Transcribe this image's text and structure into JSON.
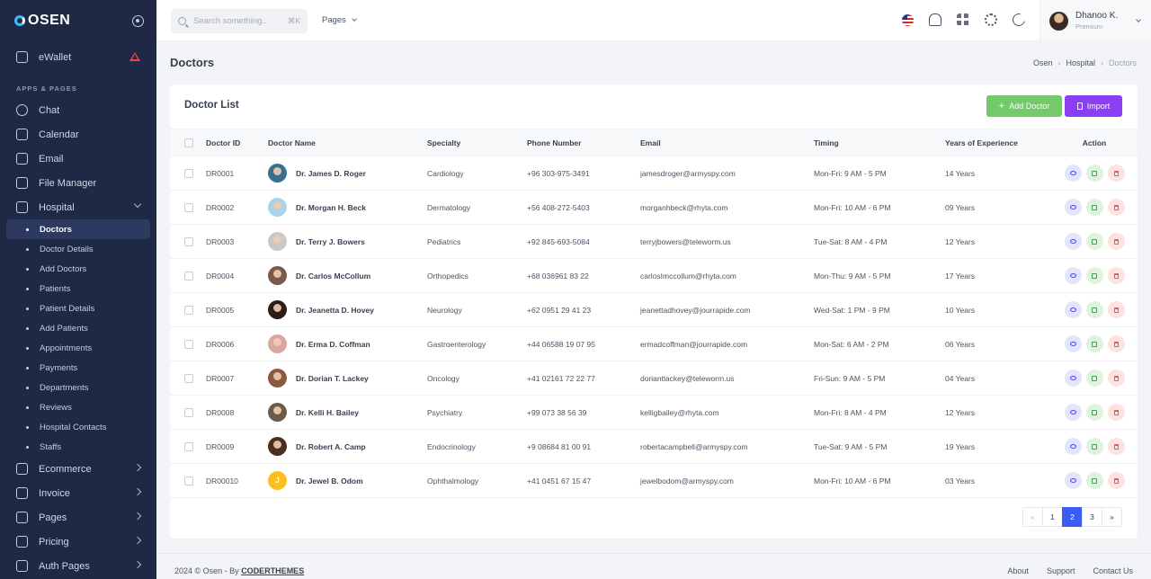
{
  "brand": "OSEN",
  "sidebar": {
    "wallet": "eWallet",
    "section_title": "APPS & PAGES",
    "items": [
      {
        "label": "Chat",
        "icon": "chat-icon"
      },
      {
        "label": "Calendar",
        "icon": "calendar-icon"
      },
      {
        "label": "Email",
        "icon": "mail-icon"
      },
      {
        "label": "File Manager",
        "icon": "folder-icon"
      },
      {
        "label": "Hospital",
        "icon": "hospital-icon"
      }
    ],
    "hospital_sub": [
      "Doctors",
      "Doctor Details",
      "Add Doctors",
      "Patients",
      "Patient Details",
      "Add Patients",
      "Appointments",
      "Payments",
      "Departments",
      "Reviews",
      "Hospital Contacts",
      "Staffs"
    ],
    "bottom_items": [
      {
        "label": "Ecommerce",
        "icon": "cart-icon"
      },
      {
        "label": "Invoice",
        "icon": "invoice-icon"
      },
      {
        "label": "Pages",
        "icon": "pages-icon"
      },
      {
        "label": "Pricing",
        "icon": "pricing-icon"
      },
      {
        "label": "Auth Pages",
        "icon": "auth-icon"
      }
    ]
  },
  "topbar": {
    "search_placeholder": "Search something..",
    "search_shortcut": "⌘K",
    "pages_menu": "Pages",
    "user_name": "Dhanoo K.",
    "user_level": "Premium"
  },
  "page": {
    "title": "Doctors",
    "breadcrumb": [
      "Osen",
      "Hospital",
      "Doctors"
    ]
  },
  "card": {
    "title": "Doctor List",
    "add_label": "Add Doctor",
    "import_label": "Import"
  },
  "table": {
    "headers": [
      "Doctor ID",
      "Doctor Name",
      "Specialty",
      "Phone Number",
      "Email",
      "Timing",
      "Years of Experience",
      "Action"
    ],
    "rows": [
      {
        "id": "DR0001",
        "name": "Dr. James D. Roger",
        "specialty": "Cardiology",
        "phone": "+96 303-975-3491",
        "email": "jamesdroger@armyspy.com",
        "timing": "Mon-Fri: 9 AM - 5 PM",
        "years": "14 Years",
        "avatar_color": "#3a6e8f"
      },
      {
        "id": "DR0002",
        "name": "Dr. Morgan H. Beck",
        "specialty": "Dermatology",
        "phone": "+56 408-272-5403",
        "email": "morganhbeck@rhyta.com",
        "timing": "Mon-Fri: 10 AM - 6 PM",
        "years": "09 Years",
        "avatar_color": "#a9d3ea"
      },
      {
        "id": "DR0003",
        "name": "Dr. Terry J. Bowers",
        "specialty": "Pediatrics",
        "phone": "+92 845-693-5084",
        "email": "terryjbowers@teleworm.us",
        "timing": "Tue-Sat: 8 AM - 4 PM",
        "years": "12 Years",
        "avatar_color": "#c9c9c9"
      },
      {
        "id": "DR0004",
        "name": "Dr. Carlos McCollum",
        "specialty": "Orthopedics",
        "phone": "+68 036961 83 22",
        "email": "carlosImccollum@rhyta.com",
        "timing": "Mon-Thu: 9 AM - 5 PM",
        "years": "17 Years",
        "avatar_color": "#7a5a4a"
      },
      {
        "id": "DR0005",
        "name": "Dr. Jeanetta D. Hovey",
        "specialty": "Neurology",
        "phone": "+62 0951 29 41 23",
        "email": "jeanettadhovey@jourrapide.com",
        "timing": "Wed-Sat: 1 PM - 9 PM",
        "years": "10 Years",
        "avatar_color": "#2b1d18"
      },
      {
        "id": "DR0006",
        "name": "Dr. Erma D. Coffman",
        "specialty": "Gastroenterology",
        "phone": "+44 06588 19 07 95",
        "email": "ermadcoffman@jourrapide.com",
        "timing": "Mon-Sat: 6 AM - 2 PM",
        "years": "06 Years",
        "avatar_color": "#d9a7a3"
      },
      {
        "id": "DR0007",
        "name": "Dr. Dorian T. Lackey",
        "specialty": "Oncology",
        "phone": "+41 02161 72 22 77",
        "email": "doriantlackey@teleworm.us",
        "timing": "Fri-Sun: 9 AM - 5 PM",
        "years": "04 Years",
        "avatar_color": "#8a5a3f"
      },
      {
        "id": "DR0008",
        "name": "Dr. Kelli H. Bailey",
        "specialty": "Psychiatry",
        "phone": "+99 073 38 56 39",
        "email": "kelligbailey@rhyta.com",
        "timing": "Mon-Fri: 8 AM - 4 PM",
        "years": "12 Years",
        "avatar_color": "#6e5a4a"
      },
      {
        "id": "DR0009",
        "name": "Dr. Robert A. Camp",
        "specialty": "Endocrinology",
        "phone": "+9 08684 81 00 91",
        "email": "robertacampbell@armyspy.com",
        "timing": "Tue-Sat: 9 AM - 5 PM",
        "years": "19 Years",
        "avatar_color": "#4a2e22"
      },
      {
        "id": "DR00010",
        "name": "Dr. Jewel B. Odom",
        "specialty": "Ophthalmology",
        "phone": "+41 0451 67 15 47",
        "email": "jewelbodom@armyspy.com",
        "timing": "Mon-Fri: 10 AM - 6 PM",
        "years": "03 Years",
        "avatar_letter": "J"
      }
    ]
  },
  "pagination": [
    "«",
    "1",
    "2",
    "3",
    "»"
  ],
  "pagination_active": "2",
  "footer": {
    "copyright": "2024 © Osen - By",
    "author": "CODERTHEMES",
    "links": [
      "About",
      "Support",
      "Contact Us"
    ]
  }
}
